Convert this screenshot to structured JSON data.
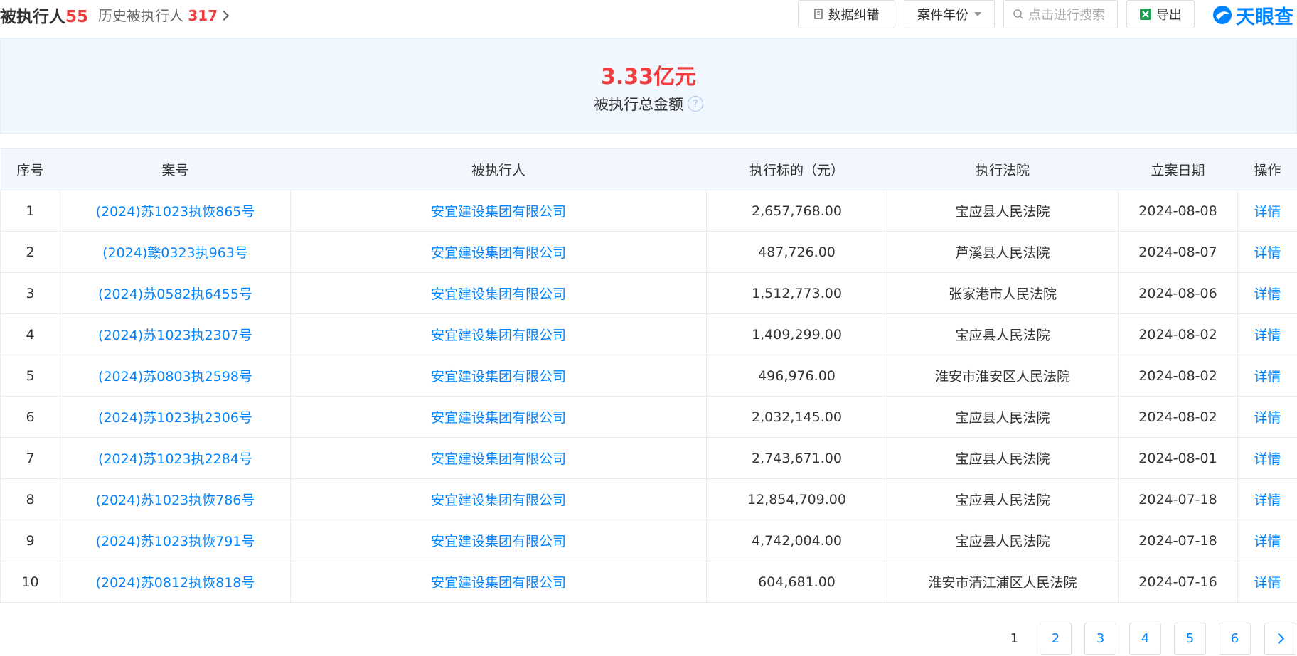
{
  "header": {
    "tab_main_label": "被执行人",
    "tab_main_count": "55",
    "tab_history_label": "历史被执行人",
    "tab_history_count": "317",
    "correction_label": "数据纠错",
    "year_label": "案件年份",
    "search_placeholder": "点击进行搜索",
    "export_label": "导出",
    "logo_text": "天眼查"
  },
  "summary": {
    "total_amount": "3.33亿元",
    "total_label": "被执行总金额",
    "help_glyph": "?"
  },
  "table": {
    "columns": [
      "序号",
      "案号",
      "被执行人",
      "执行标的（元）",
      "执行法院",
      "立案日期",
      "操作"
    ],
    "rows": [
      {
        "no": "1",
        "case": "(2024)苏1023执恢865号",
        "party": "安宜建设集团有限公司",
        "amount": "2,657,768.00",
        "court": "宝应县人民法院",
        "date": "2024-08-08",
        "action": "详情"
      },
      {
        "no": "2",
        "case": "(2024)赣0323执963号",
        "party": "安宜建设集团有限公司",
        "amount": "487,726.00",
        "court": "芦溪县人民法院",
        "date": "2024-08-07",
        "action": "详情"
      },
      {
        "no": "3",
        "case": "(2024)苏0582执6455号",
        "party": "安宜建设集团有限公司",
        "amount": "1,512,773.00",
        "court": "张家港市人民法院",
        "date": "2024-08-06",
        "action": "详情"
      },
      {
        "no": "4",
        "case": "(2024)苏1023执2307号",
        "party": "安宜建设集团有限公司",
        "amount": "1,409,299.00",
        "court": "宝应县人民法院",
        "date": "2024-08-02",
        "action": "详情"
      },
      {
        "no": "5",
        "case": "(2024)苏0803执2598号",
        "party": "安宜建设集团有限公司",
        "amount": "496,976.00",
        "court": "淮安市淮安区人民法院",
        "date": "2024-08-02",
        "action": "详情"
      },
      {
        "no": "6",
        "case": "(2024)苏1023执2306号",
        "party": "安宜建设集团有限公司",
        "amount": "2,032,145.00",
        "court": "宝应县人民法院",
        "date": "2024-08-02",
        "action": "详情"
      },
      {
        "no": "7",
        "case": "(2024)苏1023执2284号",
        "party": "安宜建设集团有限公司",
        "amount": "2,743,671.00",
        "court": "宝应县人民法院",
        "date": "2024-08-01",
        "action": "详情"
      },
      {
        "no": "8",
        "case": "(2024)苏1023执恢786号",
        "party": "安宜建设集团有限公司",
        "amount": "12,854,709.00",
        "court": "宝应县人民法院",
        "date": "2024-07-18",
        "action": "详情"
      },
      {
        "no": "9",
        "case": "(2024)苏1023执恢791号",
        "party": "安宜建设集团有限公司",
        "amount": "4,742,004.00",
        "court": "宝应县人民法院",
        "date": "2024-07-18",
        "action": "详情"
      },
      {
        "no": "10",
        "case": "(2024)苏0812执恢818号",
        "party": "安宜建设集团有限公司",
        "amount": "604,681.00",
        "court": "淮安市清江浦区人民法院",
        "date": "2024-07-16",
        "action": "详情"
      }
    ]
  },
  "pagination": {
    "pages": [
      "1",
      "2",
      "3",
      "4",
      "5",
      "6"
    ],
    "current": "1"
  },
  "colors": {
    "accent": "#0084ff",
    "highlight": "#f03c3c",
    "summary_bg": "#f0f7fe"
  }
}
